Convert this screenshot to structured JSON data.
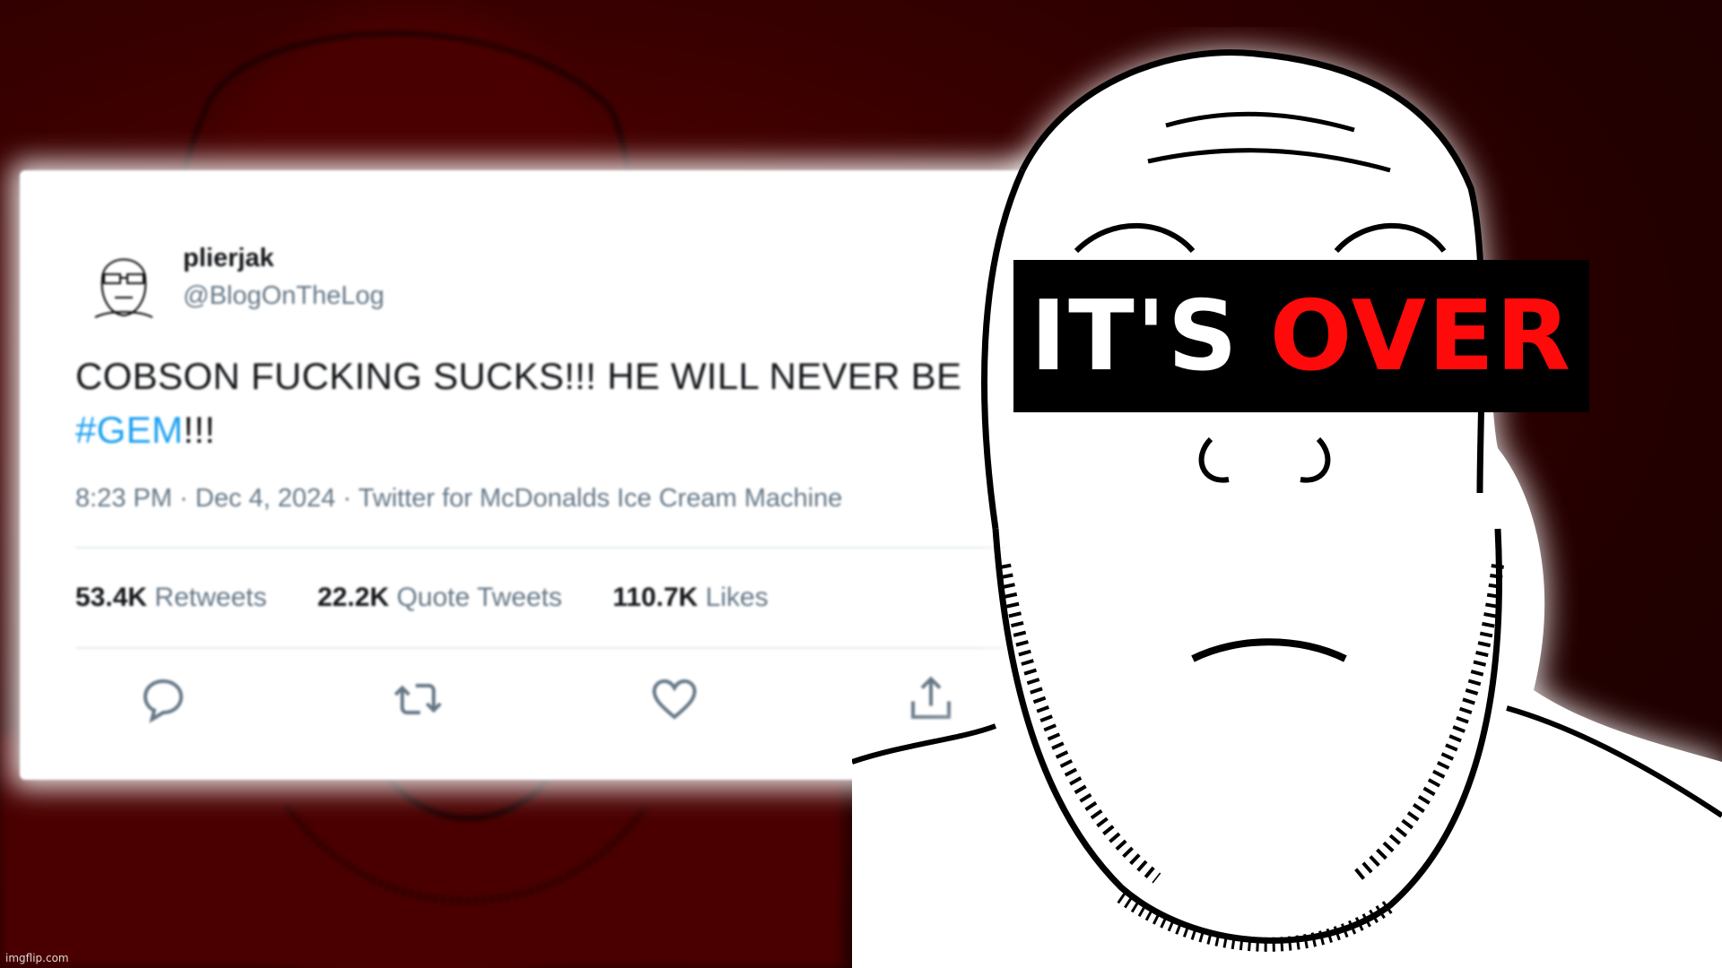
{
  "tweet": {
    "display_name": "plierjak",
    "handle": "@BlogOnTheLog",
    "text": "COBSON FUCKING SUCKS!!! HE WILL NEVER BE",
    "hashtag": "#GEM",
    "text_tail": "!!!",
    "meta": "8:23 PM · Dec 4, 2024 · Twitter for McDonalds Ice Cream Machine",
    "stats": [
      {
        "count": "53.4K",
        "label": "Retweets"
      },
      {
        "count": "22.2K",
        "label": "Quote Tweets"
      },
      {
        "count": "110.7K",
        "label": "Likes"
      }
    ],
    "actions": [
      "reply-icon",
      "retweet-icon",
      "like-icon",
      "share-icon"
    ]
  },
  "banner": {
    "word1": "IT'S",
    "word2": "OVER",
    "word1_color": "#ffffff",
    "word2_color": "#ff0a0a"
  },
  "watermark": "imgflip.com",
  "colors": {
    "background": "#2a0000",
    "link": "#1da1f2",
    "muted": "#657786"
  }
}
